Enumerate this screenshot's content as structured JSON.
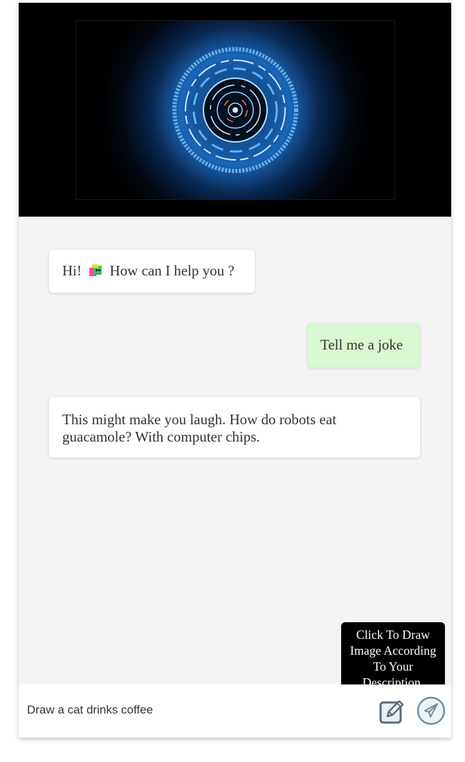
{
  "messages": [
    {
      "role": "bot",
      "text_before": "Hi!",
      "emoji": "robot-emoji",
      "text_after": "How can I help you ?"
    },
    {
      "role": "user",
      "text": "Tell me a joke"
    },
    {
      "role": "bot",
      "text": "This might make you laugh. How do robots eat guacamole? With computer chips."
    }
  ],
  "tooltip": {
    "text": "Click To Draw Image According To Your Description."
  },
  "input": {
    "value": "Draw a cat drinks coffee"
  },
  "buttons": {
    "draw_icon": "edit-image-icon",
    "send_icon": "send-paper-plane-icon"
  },
  "colors": {
    "user_bubble": "#d9f8d1",
    "bot_bubble": "#ffffff",
    "panel_bg": "#f4f4f4",
    "tooltip_bg": "#000000"
  }
}
